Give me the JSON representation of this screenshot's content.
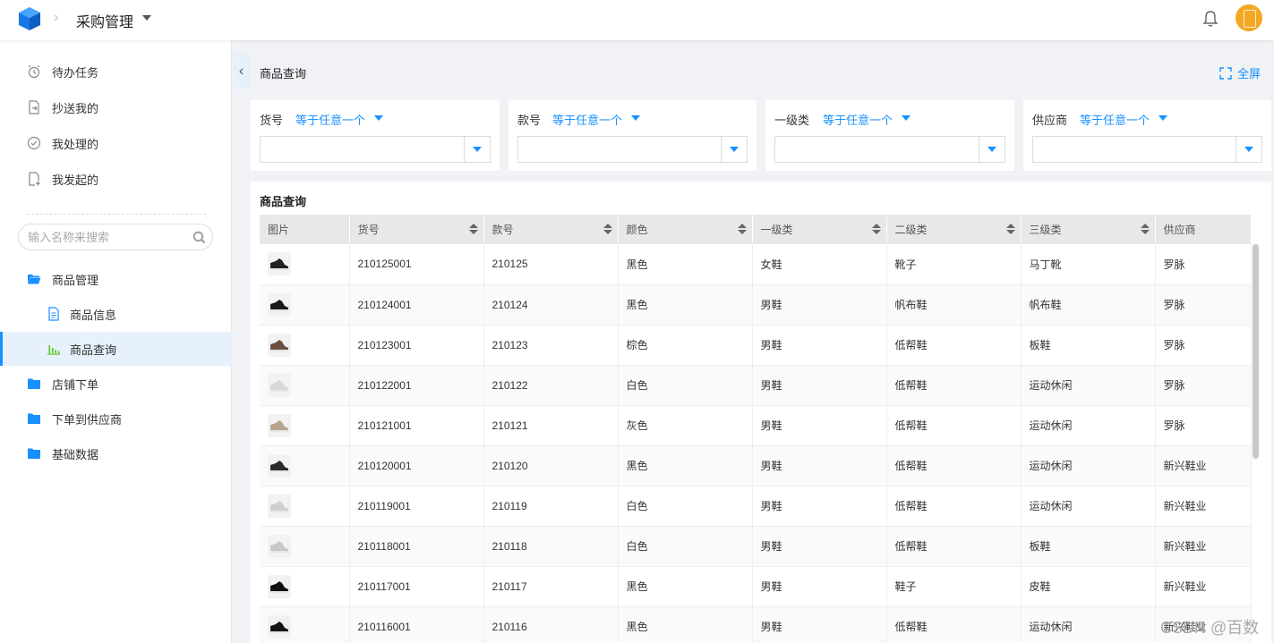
{
  "app": {
    "title": "采购管理"
  },
  "sidebar": {
    "items": [
      {
        "label": "待办任务",
        "icon": "alarm-clock-icon"
      },
      {
        "label": "抄送我的",
        "icon": "doc-forward-icon"
      },
      {
        "label": "我处理的",
        "icon": "check-circle-icon"
      },
      {
        "label": "我发起的",
        "icon": "doc-add-icon"
      }
    ],
    "search_placeholder": "输入名称来搜索",
    "tree": [
      {
        "label": "商品管理",
        "icon": "folder-open-icon"
      },
      {
        "label": "商品信息",
        "icon": "document-icon"
      },
      {
        "label": "商品查询",
        "icon": "bar-chart-icon"
      },
      {
        "label": "店铺下单",
        "icon": "folder-icon"
      },
      {
        "label": "下单到供应商",
        "icon": "folder-icon"
      },
      {
        "label": "基础数据",
        "icon": "folder-icon"
      }
    ]
  },
  "page": {
    "title": "商品查询",
    "fullscreen_label": "全屏"
  },
  "filters": [
    {
      "label": "货号",
      "operator": "等于任意一个"
    },
    {
      "label": "款号",
      "operator": "等于任意一个"
    },
    {
      "label": "一级类",
      "operator": "等于任意一个"
    },
    {
      "label": "供应商",
      "operator": "等于任意一个"
    }
  ],
  "table": {
    "title": "商品查询",
    "columns": [
      "图片",
      "货号",
      "款号",
      "颜色",
      "一级类",
      "二级类",
      "三级类",
      "供应商"
    ],
    "rows": [
      {
        "sku": "210125001",
        "style": "210125",
        "color": "黑色",
        "cat1": "女鞋",
        "cat2": "靴子",
        "cat3": "马丁靴",
        "supplier": "罗脉",
        "shoe": "#222222"
      },
      {
        "sku": "210124001",
        "style": "210124",
        "color": "黑色",
        "cat1": "男鞋",
        "cat2": "帆布鞋",
        "cat3": "帆布鞋",
        "supplier": "罗脉",
        "shoe": "#1a1a1a"
      },
      {
        "sku": "210123001",
        "style": "210123",
        "color": "棕色",
        "cat1": "男鞋",
        "cat2": "低帮鞋",
        "cat3": "板鞋",
        "supplier": "罗脉",
        "shoe": "#6b5040"
      },
      {
        "sku": "210122001",
        "style": "210122",
        "color": "白色",
        "cat1": "男鞋",
        "cat2": "低帮鞋",
        "cat3": "运动休闲",
        "supplier": "罗脉",
        "shoe": "#d8d8d8"
      },
      {
        "sku": "210121001",
        "style": "210121",
        "color": "灰色",
        "cat1": "男鞋",
        "cat2": "低帮鞋",
        "cat3": "运动休闲",
        "supplier": "罗脉",
        "shoe": "#b9a58f"
      },
      {
        "sku": "210120001",
        "style": "210120",
        "color": "黑色",
        "cat1": "男鞋",
        "cat2": "低帮鞋",
        "cat3": "运动休闲",
        "supplier": "新兴鞋业",
        "shoe": "#2a2a2a"
      },
      {
        "sku": "210119001",
        "style": "210119",
        "color": "白色",
        "cat1": "男鞋",
        "cat2": "低帮鞋",
        "cat3": "运动休闲",
        "supplier": "新兴鞋业",
        "shoe": "#cfcfcf"
      },
      {
        "sku": "210118001",
        "style": "210118",
        "color": "白色",
        "cat1": "男鞋",
        "cat2": "低帮鞋",
        "cat3": "板鞋",
        "supplier": "新兴鞋业",
        "shoe": "#c8c8c8"
      },
      {
        "sku": "210117001",
        "style": "210117",
        "color": "黑色",
        "cat1": "男鞋",
        "cat2": "鞋子",
        "cat3": "皮鞋",
        "supplier": "新兴鞋业",
        "shoe": "#111111"
      },
      {
        "sku": "210116001",
        "style": "210116",
        "color": "黑色",
        "cat1": "男鞋",
        "cat2": "低帮鞋",
        "cat3": "运动休闲",
        "supplier": "新兴鞋业",
        "shoe": "#151515"
      }
    ]
  },
  "watermark": "CSDN @百数",
  "colors": {
    "accent": "#1890ff",
    "avatar": "#f5a623"
  }
}
